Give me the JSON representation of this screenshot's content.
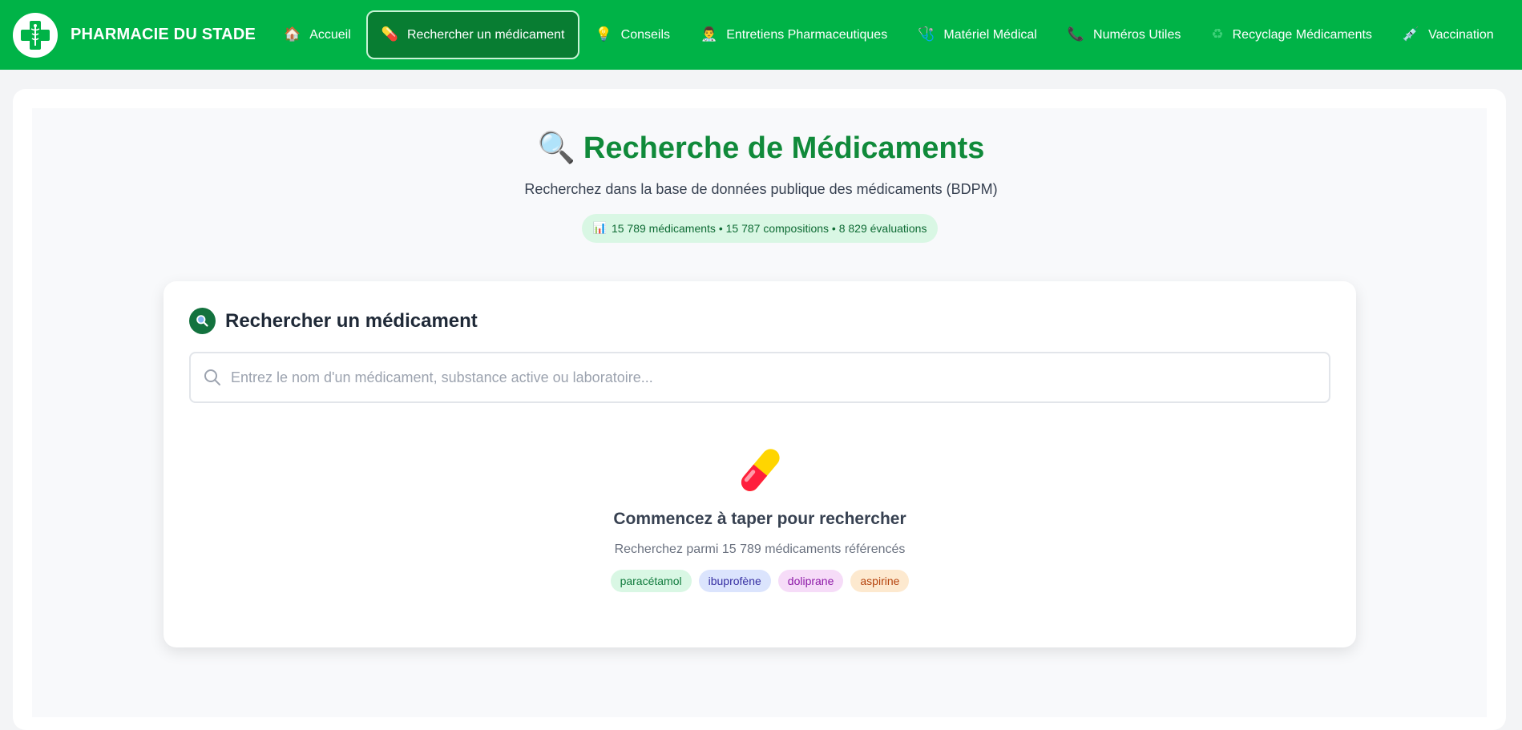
{
  "brand": {
    "name": "PHARMACIE DU STADE",
    "logo_icon": "green-cross-caduceus-icon"
  },
  "nav": {
    "items": [
      {
        "icon": "🏠",
        "icon_name": "house-icon",
        "label": "Accueil"
      },
      {
        "icon": "💊",
        "icon_name": "pill-icon",
        "label": "Rechercher un médicament",
        "active": true
      },
      {
        "icon": "💡",
        "icon_name": "lightbulb-icon",
        "label": "Conseils"
      },
      {
        "icon": "👨‍⚕️",
        "icon_name": "health-worker-icon",
        "label": "Entretiens Pharmaceutiques"
      },
      {
        "icon": "🩺",
        "icon_name": "stethoscope-icon",
        "label": "Matériel Médical"
      },
      {
        "icon": "📞",
        "icon_name": "phone-icon",
        "label": "Numéros Utiles"
      },
      {
        "icon": "♻",
        "icon_name": "recycle-icon",
        "label": "Recyclage Médicaments"
      },
      {
        "icon": "💉",
        "icon_name": "syringe-icon",
        "label": "Vaccination"
      }
    ]
  },
  "header": {
    "title_icon": "🔍",
    "title": "Recherche de Médicaments",
    "subtitle": "Recherchez dans la base de données publique des médicaments (BDPM)",
    "stats_icon": "📊",
    "stats": "15 789 médicaments • 15 787 compositions • 8 829 évaluations"
  },
  "search": {
    "heading": "Rechercher un médicament",
    "placeholder": "Entrez le nom d'un médicament, substance active ou laboratoire...",
    "value": ""
  },
  "empty_state": {
    "title": "Commencez à taper pour rechercher",
    "subtitle": "Recherchez parmi 15 789 médicaments référencés",
    "suggestions": [
      {
        "label": "paracétamol",
        "bg": "#d9f7e4",
        "fg": "#0f7a3c"
      },
      {
        "label": "ibuprofène",
        "bg": "#dbe4fd",
        "fg": "#3730a3"
      },
      {
        "label": "doliprane",
        "bg": "#f6dcf8",
        "fg": "#8e1ba8"
      },
      {
        "label": "aspirine",
        "bg": "#fde9cf",
        "fg": "#b5430c"
      }
    ]
  },
  "colors": {
    "nav_bg": "#00b347",
    "nav_active_bg": "#087d32",
    "title_green": "#108a3a"
  }
}
